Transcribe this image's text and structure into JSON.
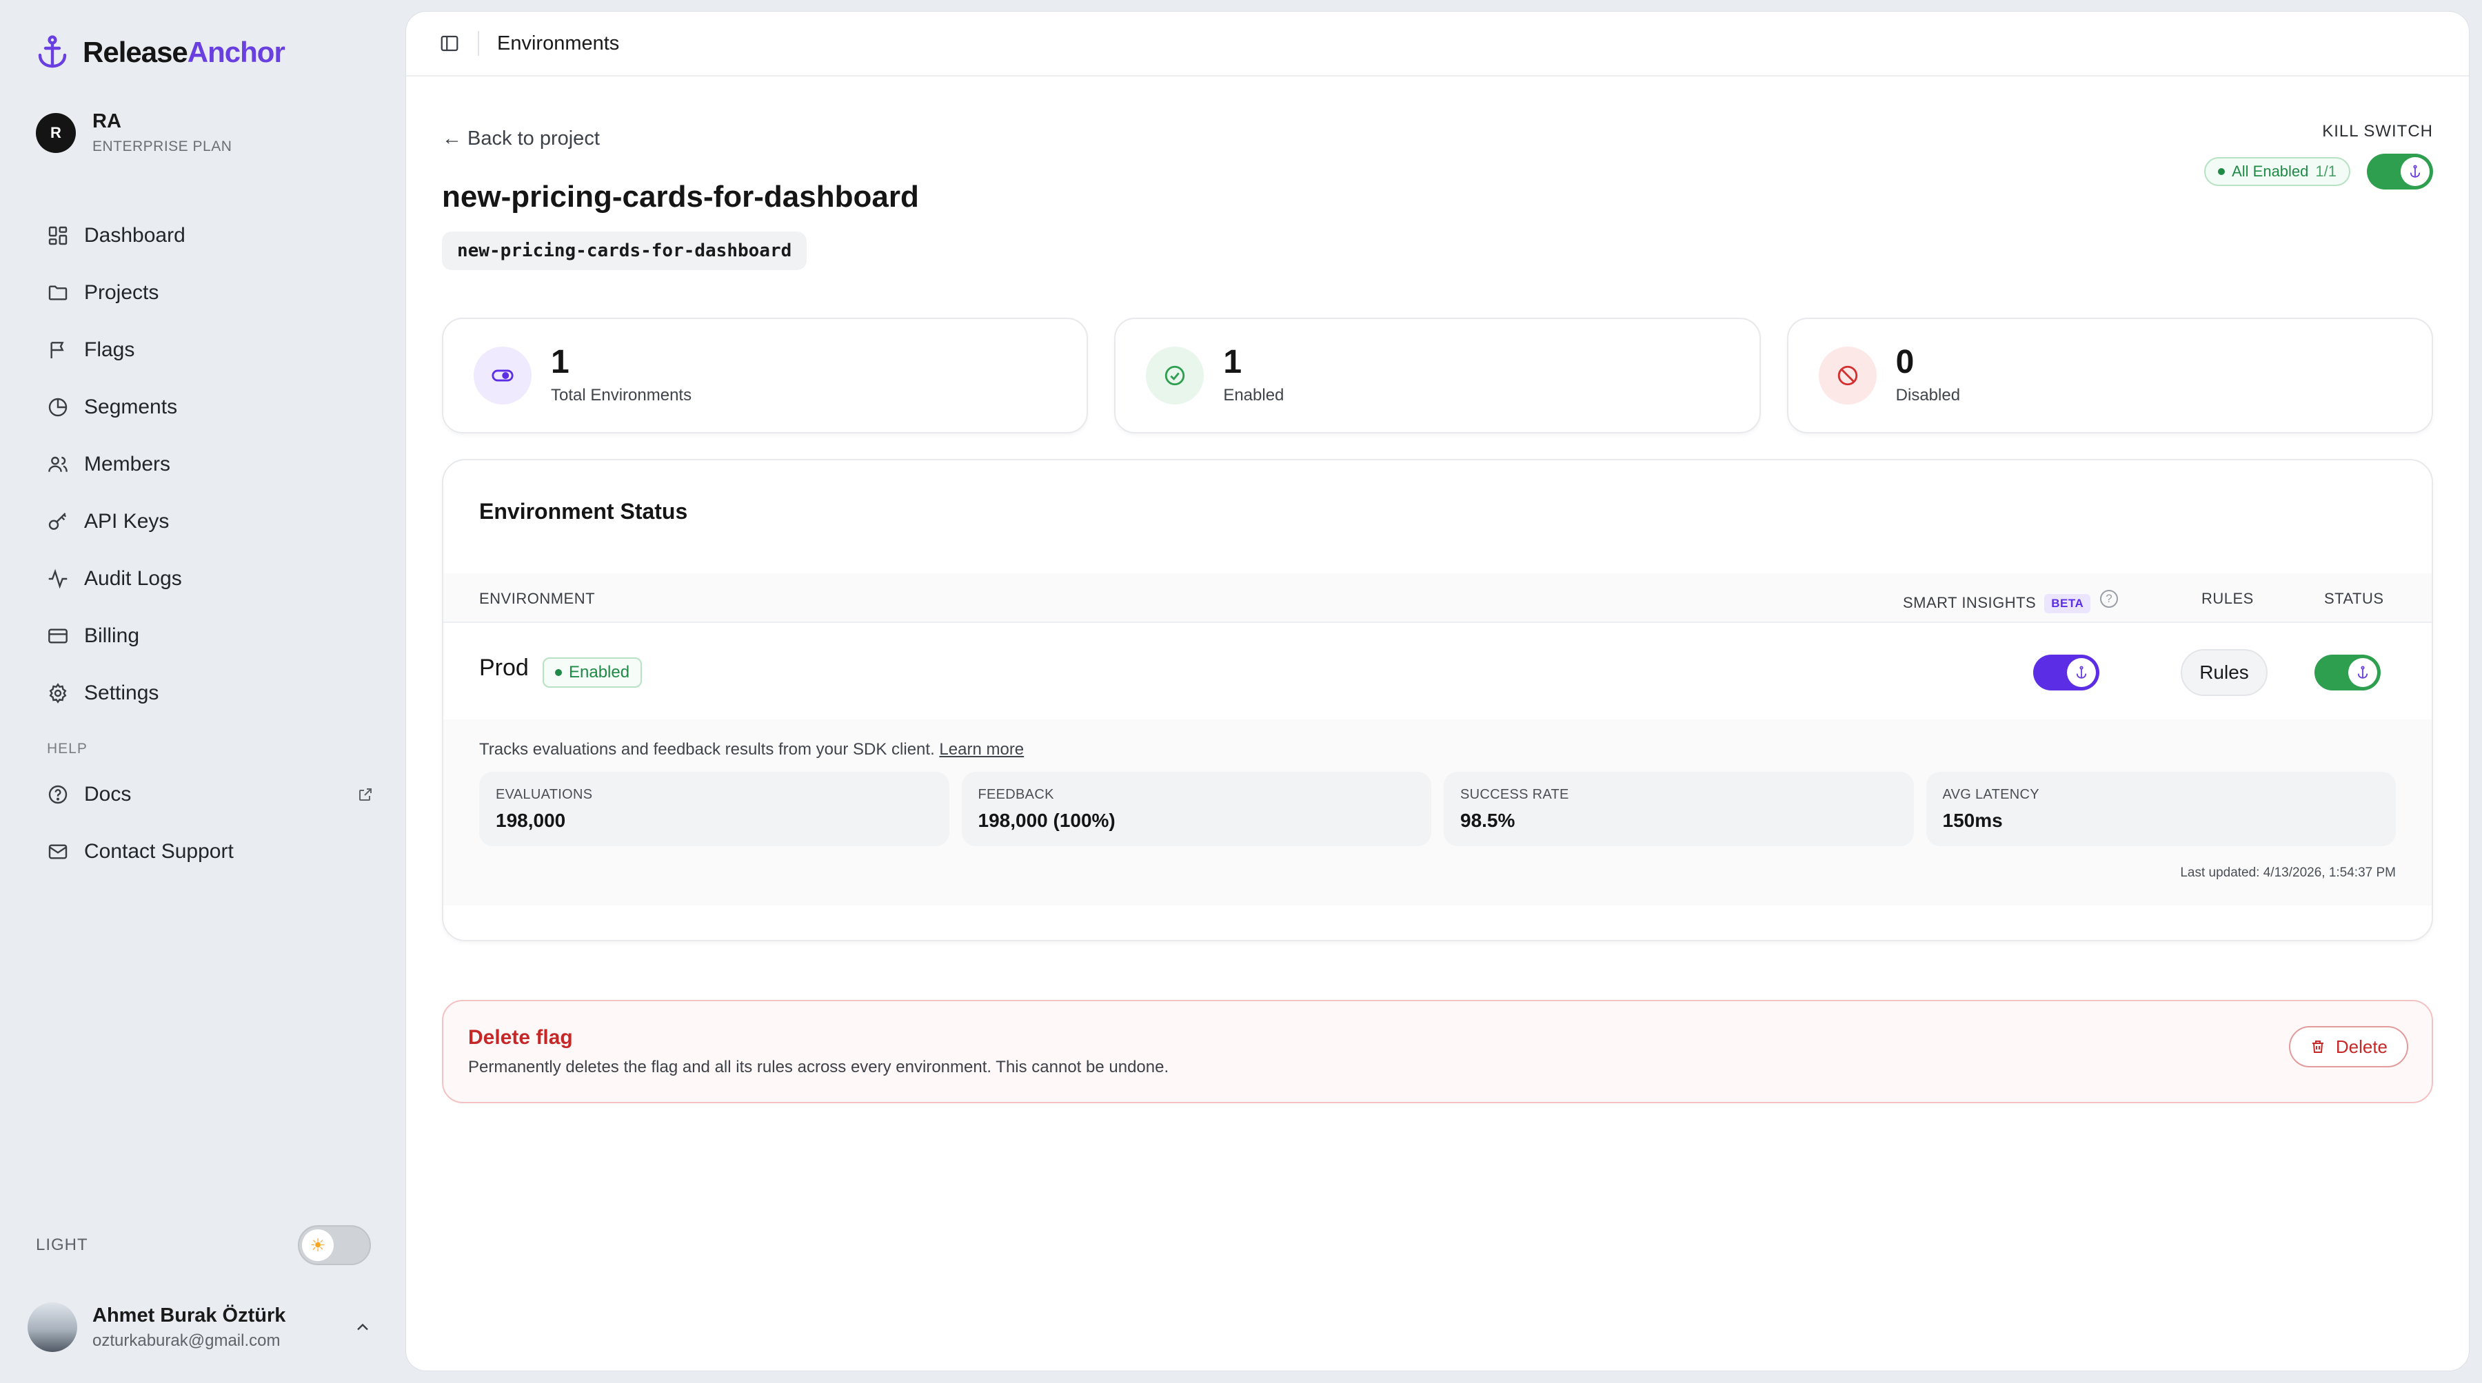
{
  "brand": {
    "name_part1": "Release",
    "name_part2": "Anchor",
    "accent_color": "#6a3fe0"
  },
  "org": {
    "initial": "R",
    "name": "RA",
    "plan": "ENTERPRISE PLAN"
  },
  "nav": {
    "items": [
      {
        "label": "Dashboard",
        "icon": "grid-icon"
      },
      {
        "label": "Projects",
        "icon": "folder-icon"
      },
      {
        "label": "Flags",
        "icon": "flag-icon"
      },
      {
        "label": "Segments",
        "icon": "pie-icon"
      },
      {
        "label": "Members",
        "icon": "users-icon"
      },
      {
        "label": "API Keys",
        "icon": "key-icon"
      },
      {
        "label": "Audit Logs",
        "icon": "activity-icon"
      },
      {
        "label": "Billing",
        "icon": "credit-card-icon"
      },
      {
        "label": "Settings",
        "icon": "gear-icon"
      }
    ],
    "help_section": "HELP",
    "help_items": [
      {
        "label": "Docs",
        "icon": "help-circle-icon"
      },
      {
        "label": "Contact Support",
        "icon": "mail-icon"
      }
    ]
  },
  "theme": {
    "label": "LIGHT",
    "mode": "light"
  },
  "user": {
    "name": "Ahmet Burak Öztürk",
    "email": "ozturkaburak@gmail.com"
  },
  "topbar": {
    "title": "Environments"
  },
  "page": {
    "back_label": "← Back to project",
    "flag_title": "new-pricing-cards-for-dashboard",
    "flag_key": "new-pricing-cards-for-dashboard"
  },
  "kill_switch": {
    "label": "KILL SWITCH",
    "status_text": "All Enabled",
    "count": "1/1",
    "enabled": true
  },
  "stats": [
    {
      "value": "1",
      "label": "Total Environments",
      "icon": "toggle-icon",
      "color": "#5b2ee6",
      "bg": "#efeafd"
    },
    {
      "value": "1",
      "label": "Enabled",
      "icon": "check-circle-icon",
      "color": "#2e9e4f",
      "bg": "#e8f6ec"
    },
    {
      "value": "0",
      "label": "Disabled",
      "icon": "ban-icon",
      "color": "#d32f2f",
      "bg": "#fde8e8"
    }
  ],
  "env_status": {
    "title": "Environment Status",
    "headers": {
      "environment": "ENVIRONMENT",
      "smart_insights": "SMART INSIGHTS",
      "beta": "BETA",
      "help": "?",
      "rules": "RULES",
      "status": "STATUS"
    },
    "rows": [
      {
        "name": "Prod",
        "badge": "Enabled",
        "smart_insights_on": true,
        "rules_label": "Rules",
        "status_on": true,
        "insights": {
          "description": "Tracks evaluations and feedback results from your SDK client.",
          "learn_more": "Learn more",
          "metrics": [
            {
              "label": "EVALUATIONS",
              "value": "198,000"
            },
            {
              "label": "FEEDBACK",
              "value": "198,000 (100%)"
            },
            {
              "label": "SUCCESS RATE",
              "value": "98.5%"
            },
            {
              "label": "AVG LATENCY",
              "value": "150ms"
            }
          ],
          "last_updated": "Last updated: 4/13/2026, 1:54:37 PM"
        }
      }
    ]
  },
  "danger": {
    "title": "Delete flag",
    "description": "Permanently deletes the flag and all its rules across every environment. This cannot be undone.",
    "button_label": "Delete"
  }
}
